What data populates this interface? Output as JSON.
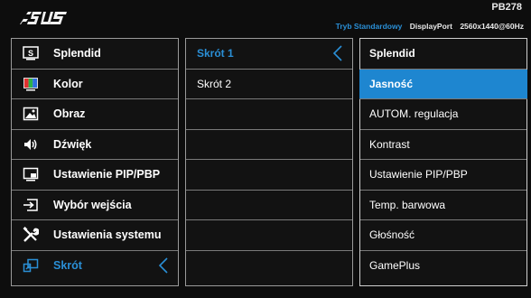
{
  "header": {
    "model": "PB278",
    "mode": "Tryb Standardowy",
    "input": "DisplayPort",
    "resolution": "2560x1440@60Hz"
  },
  "main_menu": [
    {
      "label": "Splendid",
      "icon": "splendid-icon"
    },
    {
      "label": "Kolor",
      "icon": "color-icon"
    },
    {
      "label": "Obraz",
      "icon": "image-icon"
    },
    {
      "label": "Dźwięk",
      "icon": "speaker-icon"
    },
    {
      "label": "Ustawienie PIP/PBP",
      "icon": "pip-icon"
    },
    {
      "label": "Wybór wejścia",
      "icon": "input-select-icon"
    },
    {
      "label": "Ustawienia systemu",
      "icon": "system-tools-icon"
    },
    {
      "label": "Skrót",
      "icon": "shortcut-icon",
      "selected": true
    }
  ],
  "submenu": [
    {
      "label": "Skrót 1",
      "selected": true
    },
    {
      "label": "Skrót 2"
    },
    {
      "label": ""
    },
    {
      "label": ""
    },
    {
      "label": ""
    },
    {
      "label": ""
    },
    {
      "label": ""
    },
    {
      "label": ""
    }
  ],
  "options": [
    {
      "label": "Splendid"
    },
    {
      "label": "Jasność",
      "highlighted": true
    },
    {
      "label": "AUTOM. regulacja"
    },
    {
      "label": "Kontrast"
    },
    {
      "label": "Ustawienie PIP/PBP"
    },
    {
      "label": "Temp. barwowa"
    },
    {
      "label": "Głośność"
    },
    {
      "label": "GamePlus"
    }
  ],
  "colors": {
    "accent": "#2a8fd6",
    "highlight": "#1e86d0",
    "background": "#0d0d0d"
  }
}
